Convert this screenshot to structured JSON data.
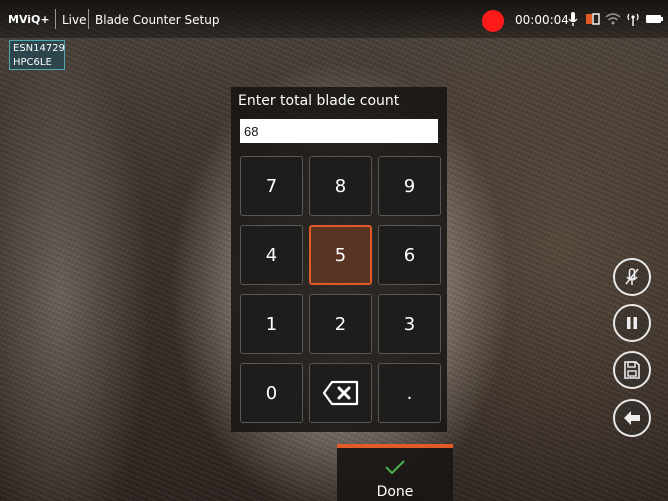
{
  "app": {
    "brand": "MViQ+",
    "mode": "Live",
    "title": "Blade Counter Setup"
  },
  "status": {
    "timer": "00:00:04",
    "recording_color": "#ff1a1a"
  },
  "overlay": {
    "esn_line1": "ESN14729",
    "esn_line2": "HPC6LE"
  },
  "dialog": {
    "prompt": "Enter total blade count",
    "value": "68",
    "keys": [
      "7",
      "8",
      "9",
      "4",
      "5",
      "6",
      "1",
      "2",
      "3",
      "0",
      "backspace",
      "."
    ],
    "active_key": "5"
  },
  "done": {
    "label": "Done"
  },
  "colors": {
    "accent": "#e25a26",
    "done_check": "#4caf50"
  },
  "side_buttons": [
    "mic-mute-icon",
    "pause-icon",
    "save-icon",
    "back-arrow-icon"
  ]
}
